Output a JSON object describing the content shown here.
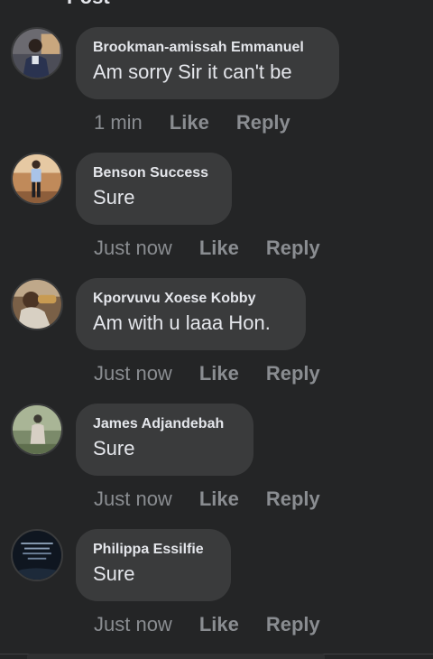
{
  "header": {
    "title": "Post"
  },
  "comments": [
    {
      "author": "Brookman-amissah Emmanuel",
      "text": "Am sorry Sir it can't be",
      "time": "1 min",
      "like": "Like",
      "reply": "Reply",
      "avatar_icon": "user-photo-icon"
    },
    {
      "author": "Benson Success",
      "text": "Sure",
      "time": "Just now",
      "like": "Like",
      "reply": "Reply",
      "avatar_icon": "user-photo-icon"
    },
    {
      "author": "Kporvuvu Xoese Kobby",
      "text": "Am with u laaa Hon.",
      "time": "Just now",
      "like": "Like",
      "reply": "Reply",
      "avatar_icon": "user-photo-icon"
    },
    {
      "author": "James Adjandebah",
      "text": "Sure",
      "time": "Just now",
      "like": "Like",
      "reply": "Reply",
      "avatar_icon": "user-photo-icon"
    },
    {
      "author": "Philippa Essilfie",
      "text": "Sure",
      "time": "Just now",
      "like": "Like",
      "reply": "Reply",
      "avatar_icon": "user-photo-icon"
    }
  ],
  "colors": {
    "background": "#242526",
    "bubble": "#3a3b3c",
    "primary_text": "#e4e6eb",
    "secondary_text": "#8a8d91"
  }
}
